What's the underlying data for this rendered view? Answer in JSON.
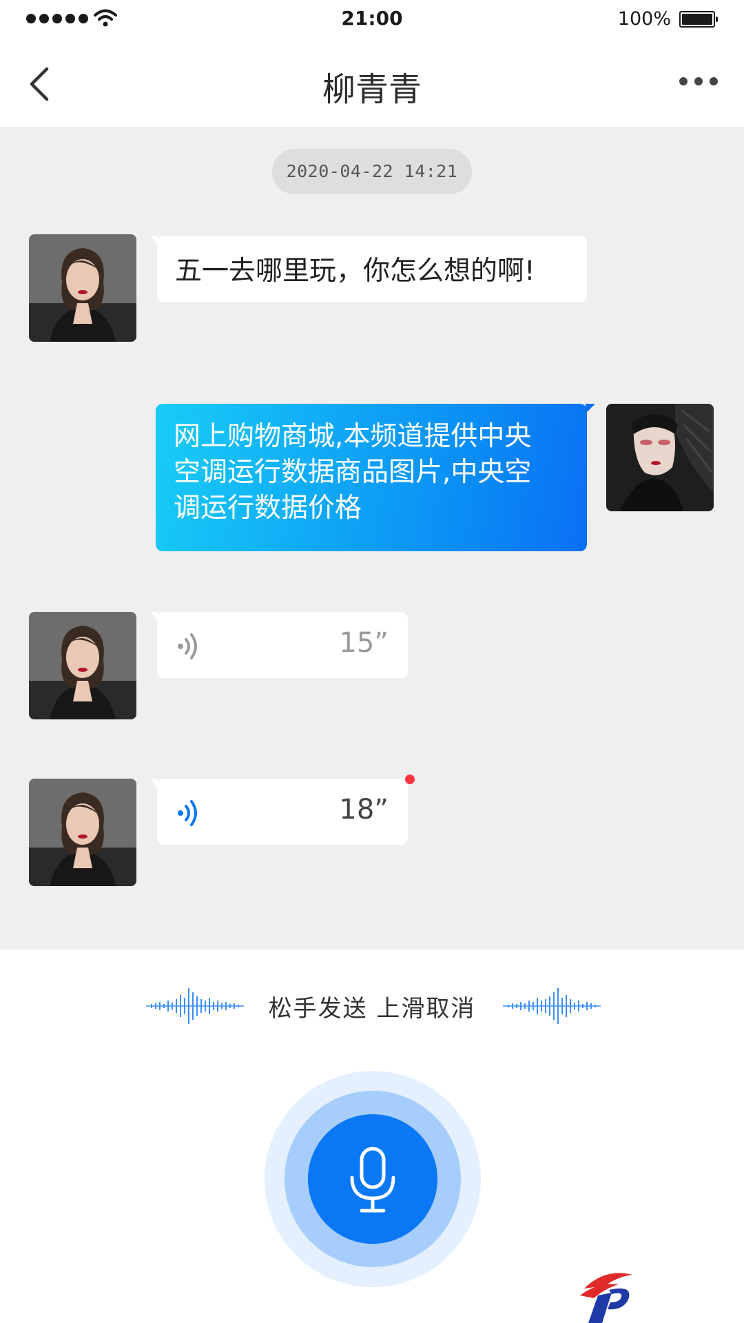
{
  "status_bar": {
    "time": "21:00",
    "battery_percent": "100%",
    "signal_icon": "signal-dots-icon",
    "wifi_icon": "wifi-icon",
    "battery_icon": "battery-icon"
  },
  "nav": {
    "title": "柳青青",
    "back_icon": "chevron-left-icon",
    "more_icon": "ellipsis-icon"
  },
  "chat": {
    "timestamp": "2020-04-22  14:21",
    "messages": [
      {
        "side": "left",
        "type": "text",
        "text": "五一去哪里玩，你怎么想的啊!"
      },
      {
        "side": "right",
        "type": "text",
        "lines": [
          "网上购物商城,本频道提供中央",
          "空调运行数据商品图片,中央空",
          "调运行数据价格"
        ]
      },
      {
        "side": "left",
        "type": "voice",
        "duration": "15”",
        "played": true
      },
      {
        "side": "left",
        "type": "voice",
        "duration": "18”",
        "played": false,
        "unread": true
      }
    ]
  },
  "record_panel": {
    "hint": "松手发送  上滑取消",
    "mic_icon": "microphone-icon"
  },
  "colors": {
    "accent": "#0a78f5",
    "bubble_gradient_start": "#18cdf6",
    "bubble_gradient_end": "#0a6ff3",
    "chat_background": "#efefef",
    "unread_dot": "#ff3344",
    "voice_played": "#9a9a9a",
    "voice_unplayed": "#0a78f5"
  }
}
